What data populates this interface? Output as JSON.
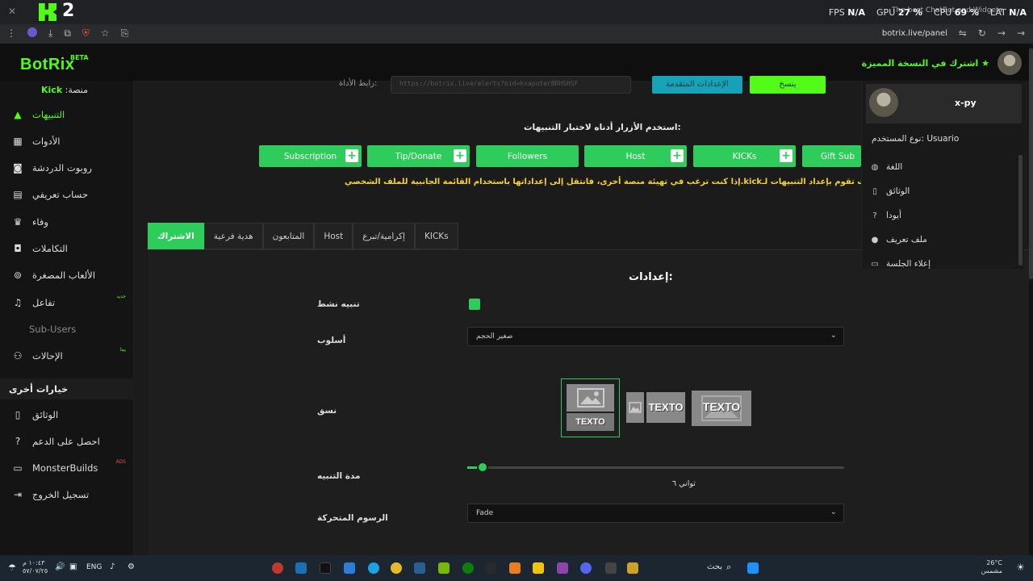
{
  "browser": {
    "app_number": "2",
    "hud": {
      "fps_label": "FPS",
      "fps_value": "N/A",
      "gpu_label": "GPU",
      "gpu_value": "27 %",
      "cpu_label": "CPU",
      "cpu_value": "69 %",
      "lat_label": "LAT",
      "lat_value": "N/A"
    },
    "tab_title": "The best ChatBot and Widgets",
    "url": "botrix.live/panel"
  },
  "header": {
    "brand": "BotRix",
    "beta": "BETA",
    "premium_link": "اشترك في النسخة المميزة"
  },
  "sidebar": {
    "platform_prefix": "منصة:",
    "platform_name": "Kick",
    "items": [
      {
        "label": "التنبيهات",
        "icon": "warning-icon"
      },
      {
        "label": "الأدوات",
        "icon": "grid-icon"
      },
      {
        "label": "روبوت الدردشة",
        "icon": "robot-icon"
      },
      {
        "label": "حساب تعريفي",
        "icon": "id-card-icon"
      },
      {
        "label": "وفاء",
        "icon": "trophy-icon"
      },
      {
        "label": "التكاملات",
        "icon": "integrations-icon"
      },
      {
        "label": "الألعاب المصغرة",
        "icon": "gamepad-icon"
      },
      {
        "label": "تفاعل",
        "icon": "music-icon",
        "tag": "جديد"
      },
      {
        "label": "Sub-Users",
        "icon": ""
      },
      {
        "label": "الإحالات",
        "icon": "users-icon",
        "tag": "بيتا"
      }
    ],
    "other_options": "خيارات أخرى",
    "other_items": [
      {
        "label": "الوثائق",
        "icon": "book-icon"
      },
      {
        "label": "احصل على الدعم",
        "icon": "help-icon"
      },
      {
        "label": "MonsterBuilds",
        "icon": "laptop-icon",
        "tag": "ADS"
      },
      {
        "label": "تسجيل الخروج",
        "icon": "logout-icon"
      }
    ]
  },
  "main": {
    "url_label": "رابط الأداة:",
    "url_value": "https://botrix.live/alerts?bid=kxaputerBRHSHSF",
    "advanced_button": "الإعدادات المتقدمة",
    "copy_button": "ينسخ",
    "test_instructions": "استخدم الأزرار أدناه لاختبار التنبيهات:",
    "test_buttons": [
      "Subscription",
      "Tip/Donate",
      "Followers",
      "Host",
      "KICKs",
      "Gift Sub"
    ],
    "warning_text": "إذا كنت ترغب في تهيئة منصة أخرى، فانتقل إلى إعداداتها باستخدام القائمة الجانبية للملف الشخصي.kickتنبيه، أنت تقوم بإعداد التنبيهات لـ: \"",
    "tabs": [
      "الاشتراك",
      "هدية فرعية",
      "المتابعون",
      "Host",
      "إكرامية/تبرع",
      "KICKs"
    ],
    "settings_title": "إعدادات:",
    "fields": {
      "active_label": "تنبيه نشط",
      "active_checked": true,
      "style_label": "أسلوب",
      "style_value": "صغير الحجم",
      "layout_label": "نسق",
      "layout_texto": "TEXTO",
      "duration_label": "مدة التنبيه",
      "duration_value": "ثواني ٦",
      "duration_fraction": 0.04,
      "animation_label": "الرسوم المتحركة",
      "animation_value": "Fade"
    }
  },
  "user_menu": {
    "username": "x-py",
    "user_type": "نوع المستخدم: Usuario",
    "items": [
      {
        "label": "اللغة",
        "icon": "globe-icon"
      },
      {
        "label": "الوثائق",
        "icon": "book-icon"
      },
      {
        "label": "أيودا",
        "icon": "help-icon"
      },
      {
        "label": "ملف تعريف",
        "icon": "user-icon"
      },
      {
        "label": "إعلاء الجلسة",
        "icon": "session-icon"
      }
    ]
  },
  "taskbar": {
    "lang": "ENG",
    "time": "١٠:٤٣ م",
    "date": "٥٧/٠٧/٢٥",
    "search": "بحث",
    "temp": "26°C",
    "weather": "مشمس"
  },
  "colors": {
    "accent": "#53fc18",
    "button_green": "#2ecc5a",
    "info": "#17a2b8",
    "warning": "#f5d22e"
  }
}
